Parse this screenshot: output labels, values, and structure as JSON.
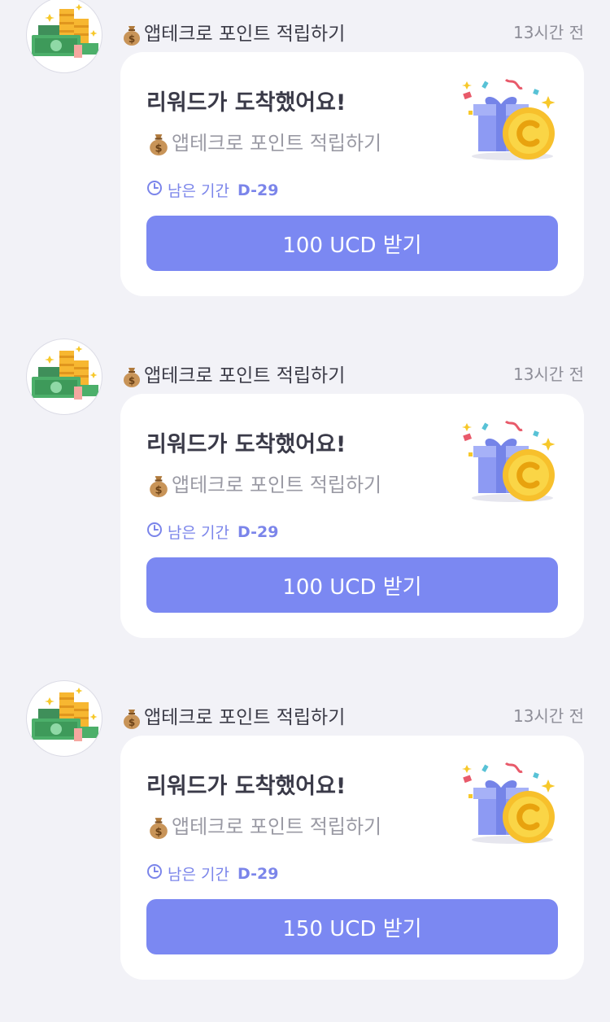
{
  "messages": [
    {
      "sender": "앱테크로 포인트 적립하기",
      "time": "13시간 전",
      "title": "리워드가 도착했어요!",
      "subtitle": "앱테크로 포인트 적립하기",
      "period_label": "남은 기간",
      "period_value": "D-29",
      "button_label": "100 UCD 받기"
    },
    {
      "sender": "앱테크로 포인트 적립하기",
      "time": "13시간 전",
      "title": "리워드가 도착했어요!",
      "subtitle": "앱테크로 포인트 적립하기",
      "period_label": "남은 기간",
      "period_value": "D-29",
      "button_label": "100 UCD 받기"
    },
    {
      "sender": "앱테크로 포인트 적립하기",
      "time": "13시간 전",
      "title": "리워드가 도착했어요!",
      "subtitle": "앱테크로 포인트 적립하기",
      "period_label": "남은 기간",
      "period_value": "D-29",
      "button_label": "150 UCD 받기"
    }
  ],
  "icons": {
    "avatar": "money-stack-icon",
    "bag": "money-bag-icon",
    "clock": "clock-icon",
    "reward": "gift-coin-icon"
  },
  "colors": {
    "background": "#f2f2f7",
    "card": "#ffffff",
    "accent": "#7b88f2",
    "period_text": "#7b85ea"
  }
}
